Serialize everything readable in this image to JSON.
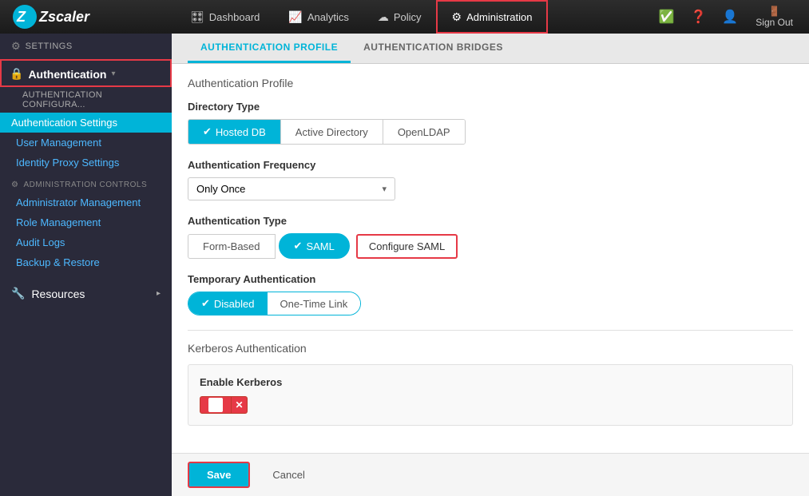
{
  "app": {
    "title": "Zscaler"
  },
  "topnav": {
    "logo": "zscaler",
    "items": [
      {
        "id": "dashboard",
        "label": "Dashboard",
        "icon": "🎛",
        "active": false
      },
      {
        "id": "analytics",
        "label": "Analytics",
        "icon": "📈",
        "active": false
      },
      {
        "id": "policy",
        "label": "Policy",
        "icon": "☁",
        "active": false
      },
      {
        "id": "administration",
        "label": "Administration",
        "icon": "⚙",
        "active": true
      }
    ],
    "right_icons": [
      "checklist",
      "help",
      "user",
      "signout"
    ],
    "signout_label": "Sign Out"
  },
  "sidebar": {
    "settings_label": "Settings",
    "authentication_label": "Authentication",
    "auth_config_label": "AUTHENTICATION CONFIGURA...",
    "auth_settings_label": "Authentication Settings",
    "user_management_label": "User Management",
    "identity_proxy_label": "Identity Proxy Settings",
    "admin_controls_label": "ADMINISTRATION CONTROLS",
    "admin_management_label": "Administrator Management",
    "role_management_label": "Role Management",
    "audit_logs_label": "Audit Logs",
    "backup_restore_label": "Backup & Restore",
    "resources_label": "Resources"
  },
  "tabs": [
    {
      "id": "profile",
      "label": "AUTHENTICATION PROFILE",
      "active": true
    },
    {
      "id": "bridges",
      "label": "AUTHENTICATION BRIDGES",
      "active": false
    }
  ],
  "form": {
    "section_title": "Authentication Profile",
    "directory_type": {
      "label": "Directory Type",
      "options": [
        {
          "id": "hosted_db",
          "label": "Hosted DB",
          "selected": true
        },
        {
          "id": "active_directory",
          "label": "Active Directory",
          "selected": false
        },
        {
          "id": "openldap",
          "label": "OpenLDAP",
          "selected": false
        }
      ]
    },
    "auth_frequency": {
      "label": "Authentication Frequency",
      "value": "Only Once",
      "placeholder": "Only Once"
    },
    "auth_type": {
      "label": "Authentication Type",
      "options": [
        {
          "id": "form_based",
          "label": "Form-Based",
          "selected": false
        },
        {
          "id": "saml",
          "label": "SAML",
          "selected": true
        },
        {
          "id": "configure_saml",
          "label": "Configure SAML",
          "is_link": true
        }
      ]
    },
    "temp_auth": {
      "label": "Temporary Authentication",
      "options": [
        {
          "id": "disabled",
          "label": "Disabled",
          "selected": true
        },
        {
          "id": "one_time_link",
          "label": "One-Time Link",
          "selected": false
        }
      ]
    },
    "kerberos": {
      "section_title": "Kerberos Authentication",
      "enable_label": "Enable Kerberos",
      "enabled": false
    }
  },
  "footer": {
    "save_label": "Save",
    "cancel_label": "Cancel"
  }
}
